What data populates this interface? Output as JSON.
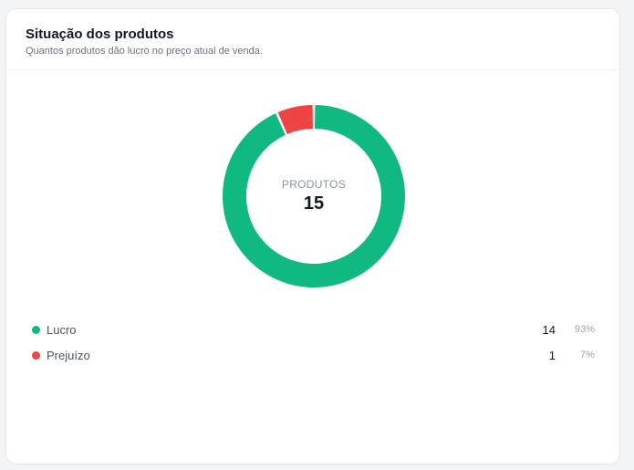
{
  "card": {
    "title": "Situação dos produtos",
    "subtitle": "Quantos produtos dão lucro no preço atual de venda."
  },
  "donut": {
    "center_caption": "PRODUTOS",
    "center_total": "15"
  },
  "colors": {
    "lucro": "#10b981",
    "prejuizo": "#ef4444"
  },
  "legend": [
    {
      "label": "Lucro",
      "count": "14",
      "pct": "93%"
    },
    {
      "label": "Prejuízo",
      "count": "1",
      "pct": "7%"
    }
  ],
  "chart_data": {
    "type": "pie",
    "categories": [
      "Lucro",
      "Prejuízo"
    ],
    "values": [
      14,
      1
    ],
    "title": "Situação dos produtos",
    "subtitle": "Quantos produtos dão lucro no preço atual de venda.",
    "legend": "bottom",
    "center_text": "PRODUTOS 15"
  }
}
